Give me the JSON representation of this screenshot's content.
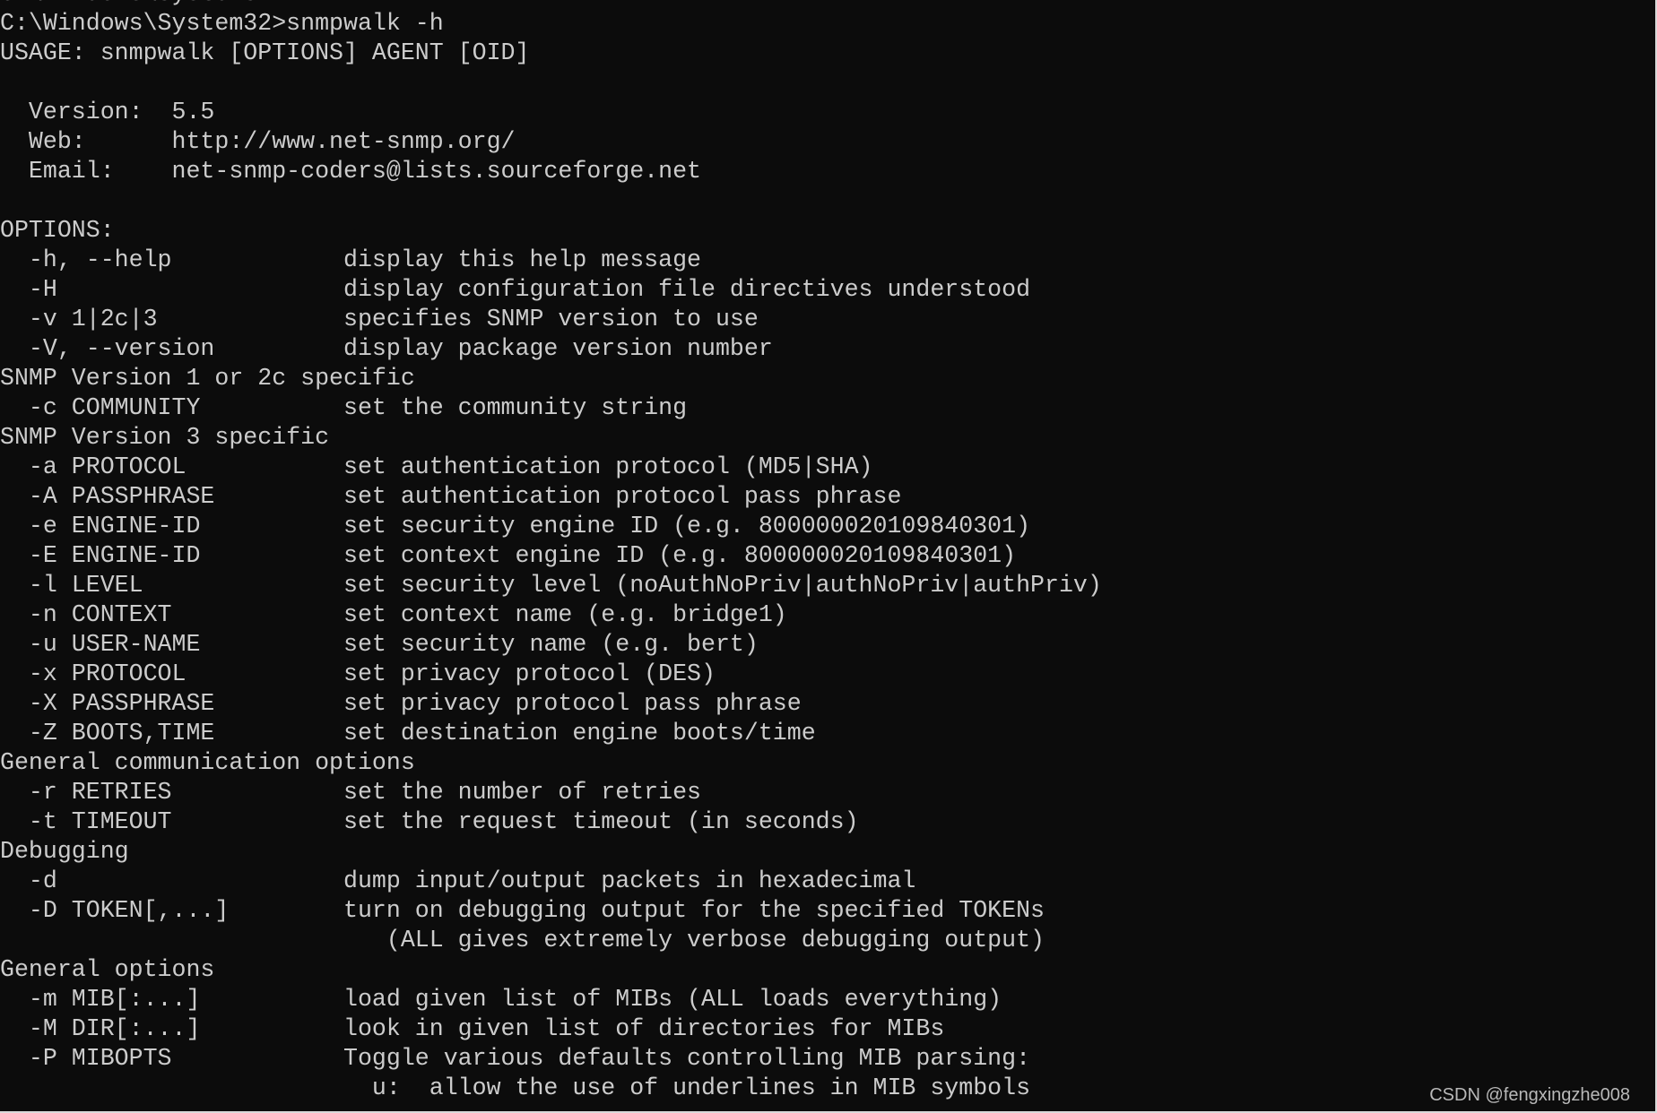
{
  "console": {
    "lines": [
      "C:\\Windows\\System32>",
      "C:\\Windows\\System32>snmpwalk -h",
      "USAGE: snmpwalk [OPTIONS] AGENT [OID]",
      "",
      "  Version:  5.5",
      "  Web:      http://www.net-snmp.org/",
      "  Email:    net-snmp-coders@lists.sourceforge.net",
      "",
      "OPTIONS:",
      "  -h, --help            display this help message",
      "  -H                    display configuration file directives understood",
      "  -v 1|2c|3             specifies SNMP version to use",
      "  -V, --version         display package version number",
      "SNMP Version 1 or 2c specific",
      "  -c COMMUNITY          set the community string",
      "SNMP Version 3 specific",
      "  -a PROTOCOL           set authentication protocol (MD5|SHA)",
      "  -A PASSPHRASE         set authentication protocol pass phrase",
      "  -e ENGINE-ID          set security engine ID (e.g. 800000020109840301)",
      "  -E ENGINE-ID          set context engine ID (e.g. 800000020109840301)",
      "  -l LEVEL              set security level (noAuthNoPriv|authNoPriv|authPriv)",
      "  -n CONTEXT            set context name (e.g. bridge1)",
      "  -u USER-NAME          set security name (e.g. bert)",
      "  -x PROTOCOL           set privacy protocol (DES)",
      "  -X PASSPHRASE         set privacy protocol pass phrase",
      "  -Z BOOTS,TIME         set destination engine boots/time",
      "General communication options",
      "  -r RETRIES            set the number of retries",
      "  -t TIMEOUT            set the request timeout (in seconds)",
      "Debugging",
      "  -d                    dump input/output packets in hexadecimal",
      "  -D TOKEN[,...]        turn on debugging output for the specified TOKENs",
      "                           (ALL gives extremely verbose debugging output)",
      "General options",
      "  -m MIB[:...]          load given list of MIBs (ALL loads everything)",
      "  -M DIR[:...]          look in given list of directories for MIBs",
      "  -P MIBOPTS            Toggle various defaults controlling MIB parsing:",
      "                          u:  allow the use of underlines in MIB symbols"
    ]
  },
  "watermark": "CSDN @fengxingzhe008",
  "colors": {
    "background": "#0c0c0c",
    "text": "#cccccc"
  }
}
